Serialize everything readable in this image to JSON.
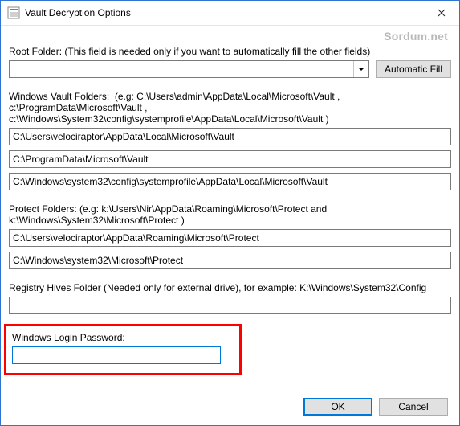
{
  "window": {
    "title": "Vault Decryption Options"
  },
  "watermark": "Sordum.net",
  "root_folder": {
    "label": "Root Folder: (This field is needed only if you want to automatically fill the other fields)",
    "value": "",
    "button": "Automatic Fill"
  },
  "vault_folders": {
    "label": "Windows Vault Folders:  (e.g: C:\\Users\\admin\\AppData\\Local\\Microsoft\\Vault , c:\\ProgramData\\Microsoft\\Vault , c:\\Windows\\System32\\config\\systemprofile\\AppData\\Local\\Microsoft\\Vault )",
    "values": [
      "C:\\Users\\velociraptor\\AppData\\Local\\Microsoft\\Vault",
      "C:\\ProgramData\\Microsoft\\Vault",
      "C:\\Windows\\system32\\config\\systemprofile\\AppData\\Local\\Microsoft\\Vault"
    ]
  },
  "protect_folders": {
    "label": "Protect Folders: (e.g: k:\\Users\\Nir\\AppData\\Roaming\\Microsoft\\Protect and k:\\Windows\\System32\\Microsoft\\Protect )",
    "values": [
      "C:\\Users\\velociraptor\\AppData\\Roaming\\Microsoft\\Protect",
      "C:\\Windows\\system32\\Microsoft\\Protect"
    ]
  },
  "registry_hives": {
    "label": "Registry Hives Folder (Needed only for external drive), for example:  K:\\Windows\\System32\\Config",
    "value": ""
  },
  "login_password": {
    "label": "Windows Login Password:",
    "value": ""
  },
  "footer": {
    "ok": "OK",
    "cancel": "Cancel"
  }
}
